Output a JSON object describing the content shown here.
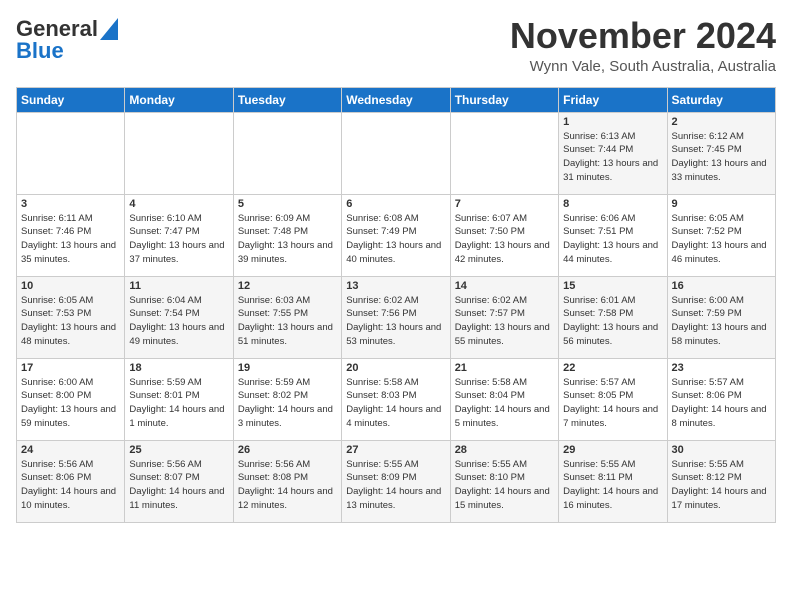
{
  "logo": {
    "line1": "General",
    "line2": "Blue"
  },
  "header": {
    "month": "November 2024",
    "location": "Wynn Vale, South Australia, Australia"
  },
  "days_of_week": [
    "Sunday",
    "Monday",
    "Tuesday",
    "Wednesday",
    "Thursday",
    "Friday",
    "Saturday"
  ],
  "weeks": [
    [
      null,
      null,
      null,
      null,
      null,
      {
        "day": "1",
        "sunrise": "6:13 AM",
        "sunset": "7:44 PM",
        "daylight": "13 hours and 31 minutes."
      },
      {
        "day": "2",
        "sunrise": "6:12 AM",
        "sunset": "7:45 PM",
        "daylight": "13 hours and 33 minutes."
      }
    ],
    [
      {
        "day": "3",
        "sunrise": "6:11 AM",
        "sunset": "7:46 PM",
        "daylight": "13 hours and 35 minutes."
      },
      {
        "day": "4",
        "sunrise": "6:10 AM",
        "sunset": "7:47 PM",
        "daylight": "13 hours and 37 minutes."
      },
      {
        "day": "5",
        "sunrise": "6:09 AM",
        "sunset": "7:48 PM",
        "daylight": "13 hours and 39 minutes."
      },
      {
        "day": "6",
        "sunrise": "6:08 AM",
        "sunset": "7:49 PM",
        "daylight": "13 hours and 40 minutes."
      },
      {
        "day": "7",
        "sunrise": "6:07 AM",
        "sunset": "7:50 PM",
        "daylight": "13 hours and 42 minutes."
      },
      {
        "day": "8",
        "sunrise": "6:06 AM",
        "sunset": "7:51 PM",
        "daylight": "13 hours and 44 minutes."
      },
      {
        "day": "9",
        "sunrise": "6:05 AM",
        "sunset": "7:52 PM",
        "daylight": "13 hours and 46 minutes."
      }
    ],
    [
      {
        "day": "10",
        "sunrise": "6:05 AM",
        "sunset": "7:53 PM",
        "daylight": "13 hours and 48 minutes."
      },
      {
        "day": "11",
        "sunrise": "6:04 AM",
        "sunset": "7:54 PM",
        "daylight": "13 hours and 49 minutes."
      },
      {
        "day": "12",
        "sunrise": "6:03 AM",
        "sunset": "7:55 PM",
        "daylight": "13 hours and 51 minutes."
      },
      {
        "day": "13",
        "sunrise": "6:02 AM",
        "sunset": "7:56 PM",
        "daylight": "13 hours and 53 minutes."
      },
      {
        "day": "14",
        "sunrise": "6:02 AM",
        "sunset": "7:57 PM",
        "daylight": "13 hours and 55 minutes."
      },
      {
        "day": "15",
        "sunrise": "6:01 AM",
        "sunset": "7:58 PM",
        "daylight": "13 hours and 56 minutes."
      },
      {
        "day": "16",
        "sunrise": "6:00 AM",
        "sunset": "7:59 PM",
        "daylight": "13 hours and 58 minutes."
      }
    ],
    [
      {
        "day": "17",
        "sunrise": "6:00 AM",
        "sunset": "8:00 PM",
        "daylight": "13 hours and 59 minutes."
      },
      {
        "day": "18",
        "sunrise": "5:59 AM",
        "sunset": "8:01 PM",
        "daylight": "14 hours and 1 minute."
      },
      {
        "day": "19",
        "sunrise": "5:59 AM",
        "sunset": "8:02 PM",
        "daylight": "14 hours and 3 minutes."
      },
      {
        "day": "20",
        "sunrise": "5:58 AM",
        "sunset": "8:03 PM",
        "daylight": "14 hours and 4 minutes."
      },
      {
        "day": "21",
        "sunrise": "5:58 AM",
        "sunset": "8:04 PM",
        "daylight": "14 hours and 5 minutes."
      },
      {
        "day": "22",
        "sunrise": "5:57 AM",
        "sunset": "8:05 PM",
        "daylight": "14 hours and 7 minutes."
      },
      {
        "day": "23",
        "sunrise": "5:57 AM",
        "sunset": "8:06 PM",
        "daylight": "14 hours and 8 minutes."
      }
    ],
    [
      {
        "day": "24",
        "sunrise": "5:56 AM",
        "sunset": "8:06 PM",
        "daylight": "14 hours and 10 minutes."
      },
      {
        "day": "25",
        "sunrise": "5:56 AM",
        "sunset": "8:07 PM",
        "daylight": "14 hours and 11 minutes."
      },
      {
        "day": "26",
        "sunrise": "5:56 AM",
        "sunset": "8:08 PM",
        "daylight": "14 hours and 12 minutes."
      },
      {
        "day": "27",
        "sunrise": "5:55 AM",
        "sunset": "8:09 PM",
        "daylight": "14 hours and 13 minutes."
      },
      {
        "day": "28",
        "sunrise": "5:55 AM",
        "sunset": "8:10 PM",
        "daylight": "14 hours and 15 minutes."
      },
      {
        "day": "29",
        "sunrise": "5:55 AM",
        "sunset": "8:11 PM",
        "daylight": "14 hours and 16 minutes."
      },
      {
        "day": "30",
        "sunrise": "5:55 AM",
        "sunset": "8:12 PM",
        "daylight": "14 hours and 17 minutes."
      }
    ]
  ]
}
